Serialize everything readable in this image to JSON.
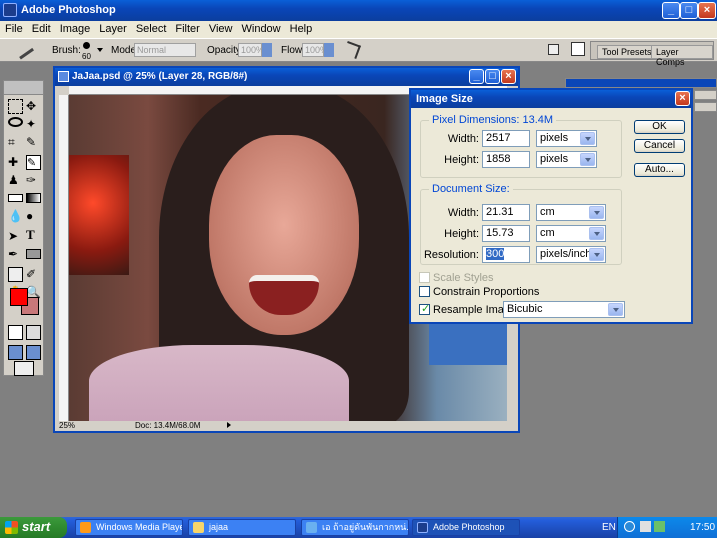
{
  "app": {
    "title": "Adobe Photoshop",
    "menu": [
      "File",
      "Edit",
      "Image",
      "Layer",
      "Select",
      "Filter",
      "View",
      "Window",
      "Help"
    ]
  },
  "options_bar": {
    "brush_label": "Brush:",
    "brush_size": "60",
    "mode_label": "Mode:",
    "mode_value": "Normal",
    "opacity_label": "Opacity:",
    "opacity_value": "100%",
    "flow_label": "Flow:",
    "flow_value": "100%",
    "well_tabs": [
      "Tool Presets",
      "Layer Comps"
    ]
  },
  "document": {
    "title": "JaJaa.psd @ 25% (Layer 28, RGB/8#)",
    "zoom": "25%",
    "doc_info": "Doc: 13.4M/68.0M"
  },
  "dialog": {
    "title": "Image Size",
    "pixel_dimensions": {
      "label": "Pixel Dimensions:",
      "size": "13.4M",
      "width_label": "Width:",
      "width_value": "2517",
      "width_unit": "pixels",
      "height_label": "Height:",
      "height_value": "1858",
      "height_unit": "pixels"
    },
    "document_size": {
      "label": "Document Size:",
      "width_label": "Width:",
      "width_value": "21.31",
      "width_unit": "cm",
      "height_label": "Height:",
      "height_value": "15.73",
      "height_unit": "cm",
      "resolution_label": "Resolution:",
      "resolution_value": "300",
      "resolution_unit": "pixels/inch"
    },
    "scale_styles": {
      "label": "Scale Styles",
      "checked": false,
      "enabled": false
    },
    "constrain": {
      "label": "Constrain Proportions",
      "checked": false
    },
    "resample": {
      "label": "Resample Image:",
      "checked": true,
      "method": "Bicubic"
    },
    "buttons": {
      "ok": "OK",
      "cancel": "Cancel",
      "auto": "Auto..."
    }
  },
  "taskbar": {
    "start": "start",
    "tasks": [
      "Windows Media Player",
      "jajaa",
      "เอ ถ้าอยู่ดันพันกากหน่...",
      "Adobe Photoshop"
    ],
    "lang": "EN",
    "clock": "17:50"
  },
  "colors": {
    "foreground": "#ff0000",
    "background": "#c8787a",
    "title_blue": "#0a46b8"
  }
}
